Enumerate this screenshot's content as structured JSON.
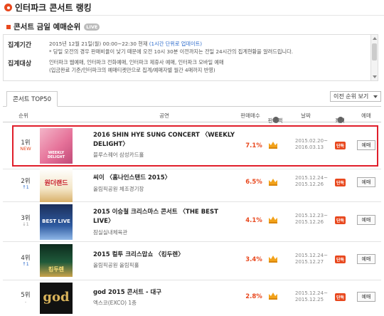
{
  "header": {
    "title": "인터파크 콘서트 랭킹"
  },
  "sub": {
    "title": "콘서트 금일 예매순위",
    "badge": "LIVE"
  },
  "info": {
    "period_label": "집계기간",
    "period_line1_a": "2015년 12월 21일(월) 00:00~22:30 현재 ",
    "period_line1_b": "(1시간 단위로 업데이트)",
    "period_line2": "* 당일 오전의 경우 판매비율이 낮기 때문에 오전 10시 30분 이전까지는 전일 24시간의 집계현황을 알려드립니다.",
    "target_label": "집계대상",
    "target_line1": "인터파크 웹예매, 인터파크 전화예매, 인터파크 제휴사 예매, 인터파크 모바일 예매",
    "target_line2": "(입금완료 기준/인터파크의 예매티켓만으로 집계/예매자별 월간 4매까지 반영)"
  },
  "tab": {
    "label": "콘서트 TOP50"
  },
  "select": {
    "label": "이전 순위 보기"
  },
  "columns": {
    "rank": "순위",
    "show": "공연",
    "share": "판매매수",
    "rate": "판매액",
    "date": "날짜",
    "seat": "좌석",
    "book": "예매"
  },
  "colors": {
    "accent": "#e8481e",
    "highlight": "#e01e2a",
    "link": "#2b6acb"
  },
  "rows": [
    {
      "rank": "1위",
      "change": "NEW",
      "title": "2016 SHIN HYE SUNG CONCERT 〈WEEKLY DELIGHT〉",
      "venue": "블루스퀘어 삼성카드홀",
      "pct": "7.1%",
      "date1": "2015.02.20~",
      "date2": "2016.03.13",
      "seat": "단독",
      "book": "예매",
      "poster": "WEEKLY DELIGHT"
    },
    {
      "rank": "2위",
      "change": "↑1",
      "title": "씨이 〈홈나인스탠드 2015〉",
      "venue": "올림픽공원 체조경기장",
      "pct": "6.5%",
      "date1": "2015.12.24~",
      "date2": "2015.12.26",
      "seat": "단독",
      "book": "예매",
      "poster": "원더랜드"
    },
    {
      "rank": "3위",
      "change": "↓1",
      "title": "2015 이승철 크리스마스 콘서트 〈THE BEST LIVE〉",
      "venue": "잠실실내체육관",
      "pct": "4.1%",
      "date1": "2015.12.23~",
      "date2": "2015.12.26",
      "seat": "단독",
      "book": "예매",
      "poster": "BEST LIVE"
    },
    {
      "rank": "4위",
      "change": "↑1",
      "title": "2015 컬투 크리스맙쇼 〈킹두렌〉",
      "venue": "올림픽공원 올림픽홀",
      "pct": "3.4%",
      "date1": "2015.12.24~",
      "date2": "2015.12.27",
      "seat": "단독",
      "book": "예매",
      "poster": "킹두렌"
    },
    {
      "rank": "5위",
      "change": "-",
      "title": "god 2015 콘서트 - 대구",
      "venue": "엑스코(EXCO) 1층",
      "pct": "2.8%",
      "date1": "2015.12.24~",
      "date2": "2015.12.25",
      "seat": "단독",
      "book": "예매",
      "poster": "god"
    }
  ]
}
